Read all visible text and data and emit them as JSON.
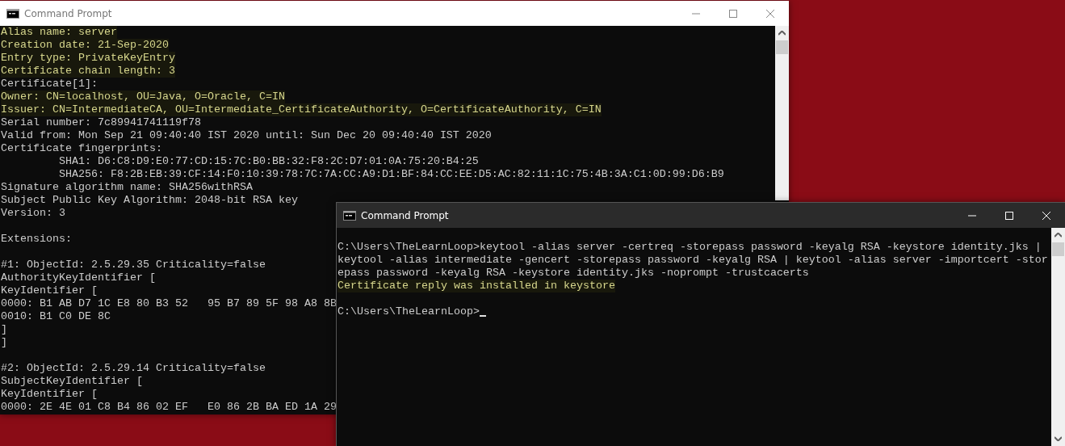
{
  "windows": [
    {
      "title": "Command Prompt",
      "active": false,
      "lines": [
        {
          "kind": "text",
          "text": "Alias name: server",
          "highlighted": true
        },
        {
          "kind": "text",
          "text": "Creation date: 21-Sep-2020",
          "highlighted": true
        },
        {
          "kind": "text",
          "text": "Entry type: PrivateKeyEntry",
          "highlighted": true
        },
        {
          "kind": "text",
          "text": "Certificate chain length: 3",
          "highlighted": true
        },
        {
          "kind": "text",
          "text": "Certificate[1]:",
          "highlighted": false
        },
        {
          "kind": "text",
          "text": "Owner: CN=localhost, OU=Java, O=Oracle, C=IN",
          "highlighted": true
        },
        {
          "kind": "text",
          "text": "Issuer: CN=IntermediateCA, OU=Intermediate_CertificateAuthority, O=CertificateAuthority, C=IN",
          "highlighted": true
        },
        {
          "kind": "text",
          "text": "Serial number: 7c89941741119f78",
          "highlighted": false
        },
        {
          "kind": "text",
          "text": "Valid from: Mon Sep 21 09:40:40 IST 2020 until: Sun Dec 20 09:40:40 IST 2020",
          "highlighted": false
        },
        {
          "kind": "text",
          "text": "Certificate fingerprints:",
          "highlighted": false
        },
        {
          "kind": "text",
          "text": "         SHA1: D6:C8:D9:E0:77:CD:15:7C:B0:BB:32:F8:2C:D7:01:0A:75:20:B4:25",
          "highlighted": false
        },
        {
          "kind": "text",
          "text": "         SHA256: F8:2B:EB:39:CF:14:F0:10:39:78:7C:7A:CC:A9:D1:BF:84:CC:EE:D5:AC:82:11:1C:75:4B:3A:C1:0D:99:D6:B9",
          "highlighted": false
        },
        {
          "kind": "text",
          "text": "Signature algorithm name: SHA256withRSA",
          "highlighted": false
        },
        {
          "kind": "text",
          "text": "Subject Public Key Algorithm: 2048-bit RSA key",
          "highlighted": false
        },
        {
          "kind": "text",
          "text": "Version: 3",
          "highlighted": false
        },
        {
          "kind": "blank"
        },
        {
          "kind": "text",
          "text": "Extensions:",
          "highlighted": false
        },
        {
          "kind": "blank"
        },
        {
          "kind": "text",
          "text": "#1: ObjectId: 2.5.29.35 Criticality=false",
          "highlighted": false
        },
        {
          "kind": "text",
          "text": "AuthorityKeyIdentifier [",
          "highlighted": false
        },
        {
          "kind": "text",
          "text": "KeyIdentifier [",
          "highlighted": false
        },
        {
          "kind": "text",
          "text": "0000: B1 AB D7 1C E8 80 B3 52   95 B7 89 5F 98 A8 8B",
          "highlighted": false
        },
        {
          "kind": "text",
          "text": "0010: B1 C0 DE 8C",
          "highlighted": false
        },
        {
          "kind": "text",
          "text": "]",
          "highlighted": false
        },
        {
          "kind": "text",
          "text": "]",
          "highlighted": false
        },
        {
          "kind": "blank"
        },
        {
          "kind": "text",
          "text": "#2: ObjectId: 2.5.29.14 Criticality=false",
          "highlighted": false
        },
        {
          "kind": "text",
          "text": "SubjectKeyIdentifier [",
          "highlighted": false
        },
        {
          "kind": "text",
          "text": "KeyIdentifier [",
          "highlighted": false
        },
        {
          "kind": "text",
          "text": "0000: 2E 4E 01 C8 B4 86 02 EF   E0 86 2B BA ED 1A 29",
          "highlighted": false
        }
      ]
    },
    {
      "title": "Command Prompt",
      "active": true,
      "lines": [
        {
          "kind": "blank"
        },
        {
          "kind": "text",
          "text": "C:\\Users\\TheLearnLoop>keytool -alias server -certreq -storepass password -keyalg RSA -keystore identity.jks |",
          "highlighted": false
        },
        {
          "kind": "text",
          "text": "keytool -alias intermediate -gencert -storepass password -keyalg RSA | keytool -alias server -importcert -stor",
          "highlighted": false
        },
        {
          "kind": "text",
          "text": "epass password -keyalg RSA -keystore identity.jks -noprompt -trustcacerts",
          "highlighted": false
        },
        {
          "kind": "text",
          "text": "Certificate reply was installed in keystore",
          "highlighted": true
        },
        {
          "kind": "blank"
        },
        {
          "kind": "text",
          "text": "C:\\Users\\TheLearnLoop>",
          "highlighted": false,
          "cursor": true
        }
      ]
    }
  ]
}
